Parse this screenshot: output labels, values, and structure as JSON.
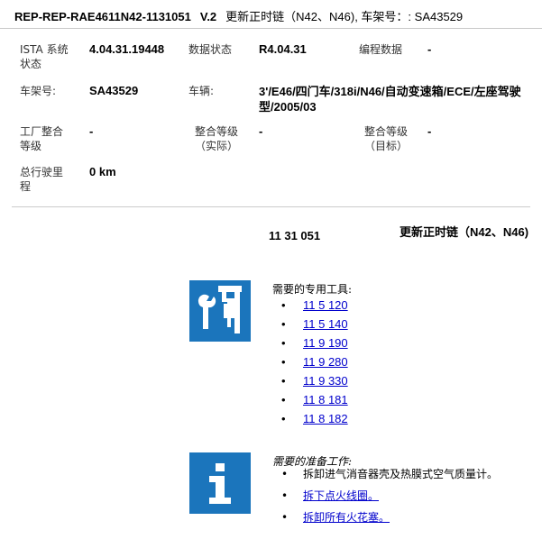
{
  "header": {
    "doc_id": "REP-REP-RAE4611N42-1131051",
    "version": "V.2",
    "description": "更新正时链（N42、N46), 车架号：: SA43529"
  },
  "info": {
    "ista_label": "ISTA 系统\n状态",
    "ista_value": "4.04.31.19448",
    "data_status_label": "数据状态",
    "data_status_value": "R4.04.31",
    "prog_label": "编程数据",
    "prog_value": "-",
    "vin_label": "车架号:",
    "vin_value": "SA43529",
    "vehicle_label": "车辆:",
    "vehicle_value": "3'/E46/四门车/318i/N46/自动变速箱/ECE/左座驾驶型/2005/03",
    "factory_label": "工厂整合\n等级",
    "factory_value": "-",
    "level_actual_label": "整合等级\n（实际）",
    "level_actual_value": "-",
    "level_target_label": "整合等级\n（目标）",
    "level_target_value": "-",
    "mileage_label": "总行驶里\n程",
    "mileage_value": "0 km"
  },
  "repair": {
    "number": "11 31 051",
    "title": "更新正时链（N42、N46)"
  },
  "tools": {
    "heading": "需要的专用工具:",
    "icon": "special-tools-icon",
    "items": [
      "11 5 120",
      "11 5 140",
      "11 9 190",
      "11 9 280",
      "11 9 330",
      "11 8 181",
      "11 8 182"
    ]
  },
  "prep": {
    "heading": "需要的准备工作:",
    "icon": "info-icon",
    "items": [
      "拆卸进气消音器壳及热膜式空气质量计。",
      "拆下点火线圈。",
      "拆卸所有火花塞。"
    ]
  },
  "colors": {
    "icon_blue": "#1b75bc",
    "link": "#0000cc"
  }
}
